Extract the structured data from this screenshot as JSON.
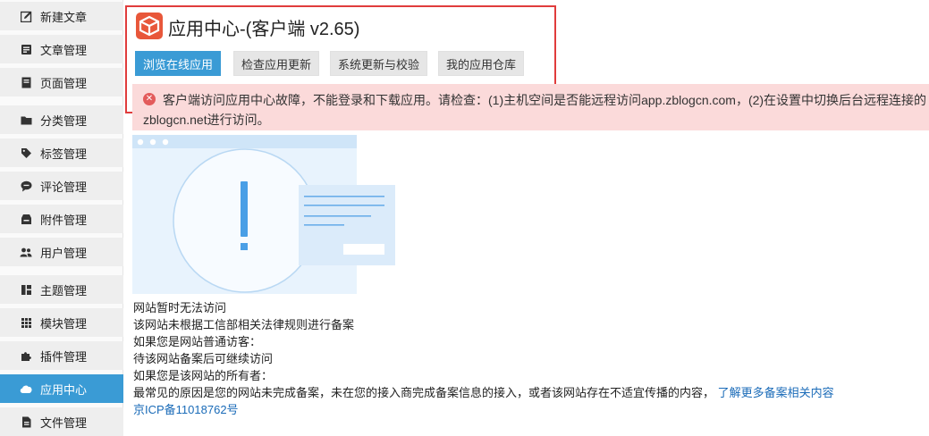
{
  "sidebar": {
    "items": [
      {
        "label": "新建文章",
        "icon": "edit-icon",
        "active": false
      },
      {
        "label": "文章管理",
        "icon": "article-icon",
        "active": false
      },
      {
        "label": "页面管理",
        "icon": "page-icon",
        "active": false
      },
      {
        "label": "分类管理",
        "icon": "folder-icon",
        "active": false
      },
      {
        "label": "标签管理",
        "icon": "tag-icon",
        "active": false
      },
      {
        "label": "评论管理",
        "icon": "comment-icon",
        "active": false
      },
      {
        "label": "附件管理",
        "icon": "attachment-icon",
        "active": false
      },
      {
        "label": "用户管理",
        "icon": "users-icon",
        "active": false
      },
      {
        "label": "主题管理",
        "icon": "theme-icon",
        "active": false
      },
      {
        "label": "模块管理",
        "icon": "grid-icon",
        "active": false
      },
      {
        "label": "插件管理",
        "icon": "puzzle-icon",
        "active": false
      },
      {
        "label": "应用中心",
        "icon": "cloud-icon",
        "active": true
      },
      {
        "label": "文件管理",
        "icon": "file-icon",
        "active": false
      }
    ]
  },
  "header": {
    "title": "应用中心-(客户端 v2.65)",
    "tabs": [
      {
        "label": "浏览在线应用",
        "active": true
      },
      {
        "label": "检查应用更新",
        "active": false
      },
      {
        "label": "系统更新与校验",
        "active": false
      },
      {
        "label": "我的应用仓库",
        "active": false
      }
    ]
  },
  "error": {
    "line1": "客户端访问应用中心故障，不能登录和下载应用。请检查：(1)主机空间是否能远程访问app.zblogcn.com，(2)在设置中切换后台远程连接的",
    "line2": "zblogcn.net进行访问。"
  },
  "notice": {
    "line1": "网站暂时无法访问",
    "line2": "该网站未根据工信部相关法律规则进行备案",
    "line3": "如果您是网站普通访客：",
    "line4": "待该网站备案后可继续访问",
    "line5": "如果您是该网站的所有者：",
    "line6": "最常见的原因是您的网站未完成备案，未在您的接入商完成备案信息的接入，或者该网站存在不适宜传播的内容，",
    "link": "了解更多备案相关内容",
    "icp": "京ICP备11018762号"
  },
  "colors": {
    "accent": "#3a9bd5",
    "highlight_border": "#e03c3c",
    "error_bg": "#fbdada",
    "error_icon": "#e35b5b",
    "logo": "#e8573a"
  }
}
